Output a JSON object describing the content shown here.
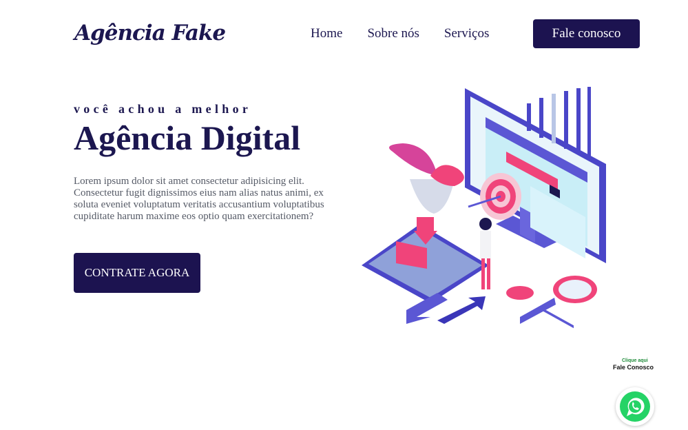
{
  "brand": {
    "logo": "Agência Fake"
  },
  "nav": {
    "items": [
      {
        "label": "Home"
      },
      {
        "label": "Sobre nós"
      },
      {
        "label": "Serviços"
      }
    ],
    "cta_label": "Fale conosco"
  },
  "hero": {
    "kicker": "você achou a melhor",
    "headline": "Agência Digital",
    "lead": "Lorem ipsum dolor sit amet consectetur adipisicing elit. Consectetur fugit dignissimos eius nam alias natus animi, ex soluta eveniet voluptatum veritatis accusantium voluptatibus cupiditate harum maxime eos optio quam exercitationem?",
    "cta_label": "CONTRATE AGORA"
  },
  "whatsapp": {
    "small_label": "Clique aqui",
    "big_label": "Fale Conosco"
  },
  "colors": {
    "primary": "#1c1350",
    "accent_pink": "#f0447a",
    "accent_blue": "#4a46c8"
  }
}
